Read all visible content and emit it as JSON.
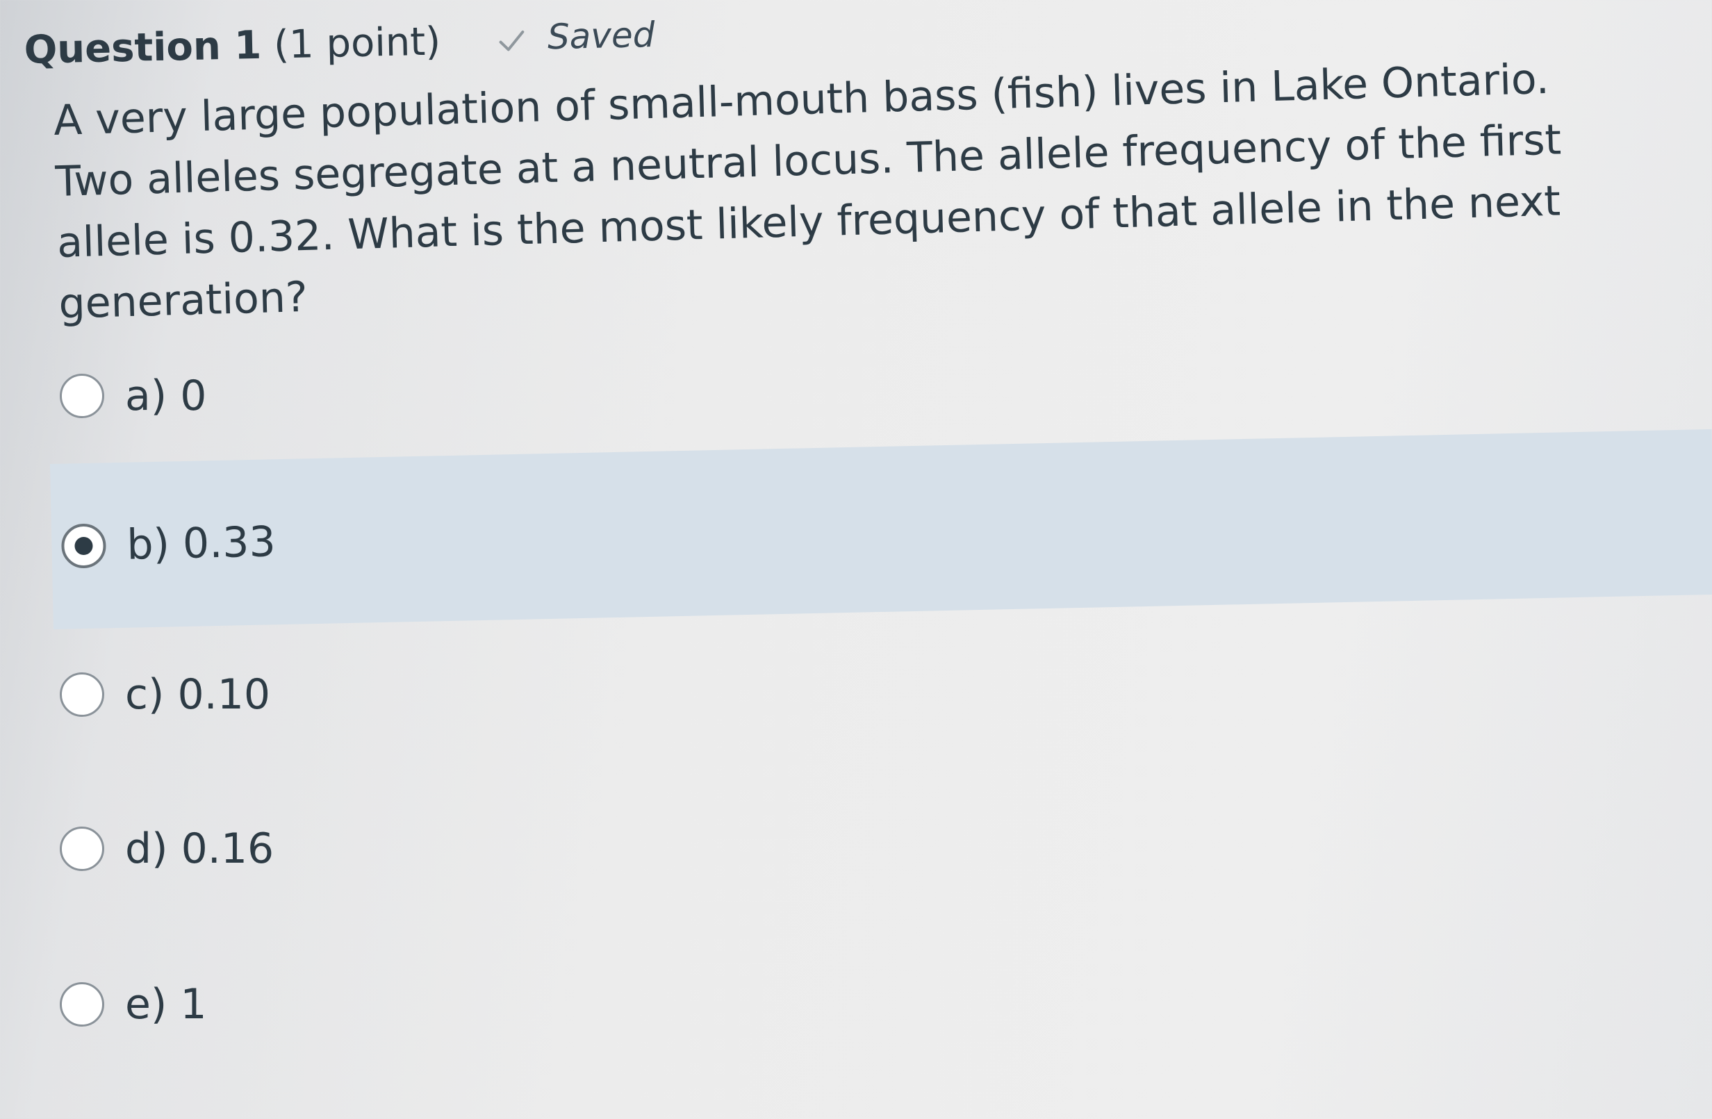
{
  "question": {
    "title": "Question 1",
    "points": "(1 point)",
    "saved_label": "Saved",
    "saved_icon": "check-icon",
    "text": "A very large population of small-mouth bass (fish) lives in Lake Ontario. Two alleles segregate at a neutral locus. The allele frequency of the first allele is 0.32. What is the most likely frequency of that allele in the next generation?"
  },
  "answers": [
    {
      "label": "a) 0",
      "selected": false
    },
    {
      "label": "b) 0.33",
      "selected": true
    },
    {
      "label": "c) 0.10",
      "selected": false
    },
    {
      "label": "d) 0.16",
      "selected": false
    },
    {
      "label": "e) 1",
      "selected": false
    }
  ],
  "colors": {
    "selected_row": "#d6e0e9",
    "text": "#2d3b45"
  }
}
